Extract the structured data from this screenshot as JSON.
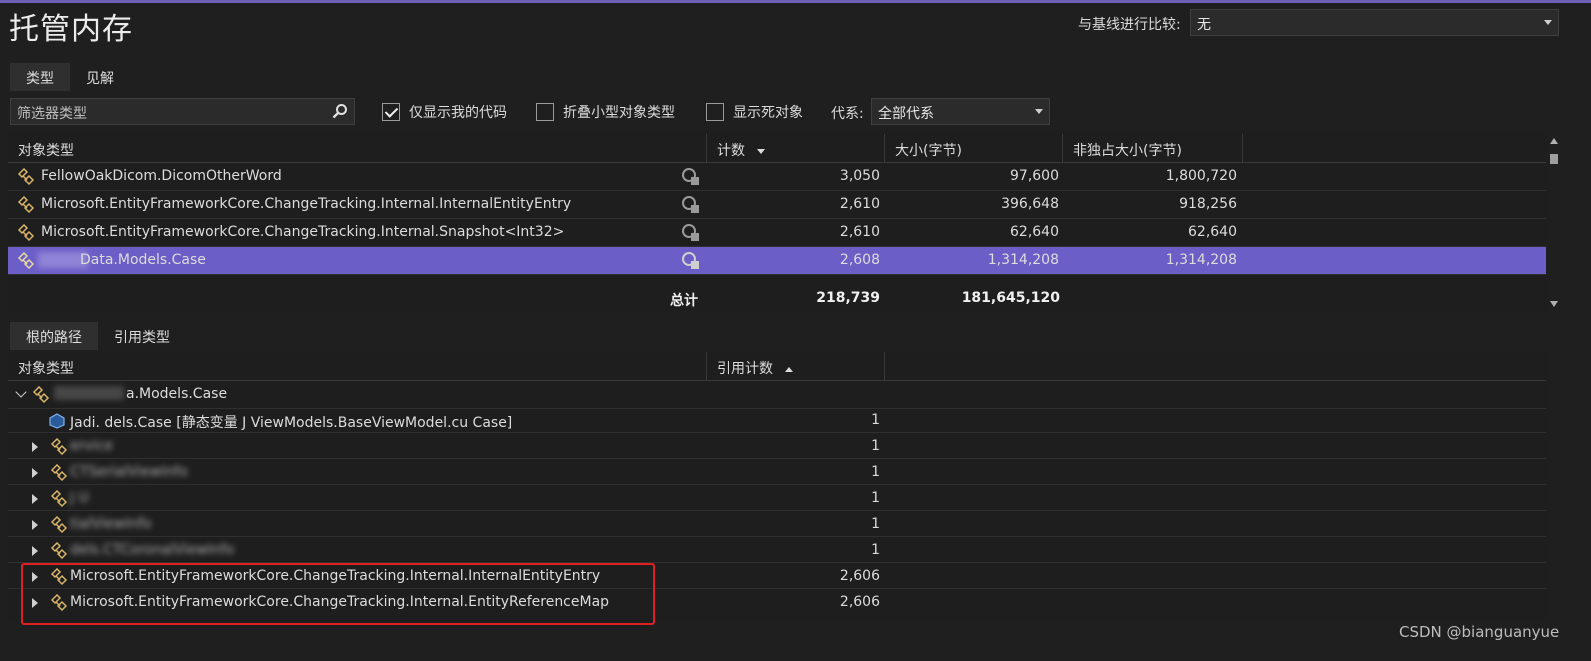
{
  "title": "托管内存",
  "compare": {
    "label": "与基线进行比较:",
    "value": "无"
  },
  "top_tabs": [
    {
      "label": "类型"
    },
    {
      "label": "见解"
    }
  ],
  "toolbar": {
    "filter_placeholder": "筛选器类型",
    "just_my_code": {
      "label": "仅显示我的代码",
      "checked": true
    },
    "collapse_small": {
      "label": "折叠小型对象类型",
      "checked": false
    },
    "show_dead": {
      "label": "显示死对象",
      "checked": false
    },
    "generation_label": "代系:",
    "generation_value": "全部代系"
  },
  "types_table": {
    "headers": {
      "type": "对象类型",
      "count": "计数",
      "size": "大小(字节)",
      "inclusive": "非独占大小(字节)"
    },
    "rows": [
      {
        "type": "FellowOakDicom.DicomOtherWord",
        "count": "3,050",
        "size": "97,600",
        "inclusive": "1,800,720"
      },
      {
        "type": "Microsoft.EntityFrameworkCore.ChangeTracking.Internal.InternalEntityEntry",
        "count": "2,610",
        "size": "396,648",
        "inclusive": "918,256"
      },
      {
        "type": "Microsoft.EntityFrameworkCore.ChangeTracking.Internal.Snapshot<Int32>",
        "count": "2,610",
        "size": "62,640",
        "inclusive": "62,640"
      },
      {
        "type": "Data.Models.Case",
        "count": "2,608",
        "size": "1,314,208",
        "inclusive": "1,314,208"
      }
    ],
    "total": {
      "label": "总计",
      "count": "218,739",
      "size": "181,645,120"
    }
  },
  "bottom_tabs": [
    {
      "label": "根的路径"
    },
    {
      "label": "引用类型"
    }
  ],
  "paths_table": {
    "headers": {
      "type": "对象类型",
      "ref_count": "引用计数"
    },
    "root": {
      "label": "a.Models.Case"
    },
    "rows": [
      {
        "label": "Jadi.  dels.Case [静态变量 J   ViewModels.BaseViewModel.cu   Case]",
        "count": "1"
      },
      {
        "label": "                ervice",
        "count": "1"
      },
      {
        "label": "          CTSerialViewInfo",
        "count": "1"
      },
      {
        "label": "J           U",
        "count": "1"
      },
      {
        "label": "                 tialViewInfo",
        "count": "1"
      },
      {
        "label": "           dels.CTCoronalViewInfo",
        "count": "1"
      },
      {
        "label": "Microsoft.EntityFrameworkCore.ChangeTracking.Internal.InternalEntityEntry",
        "count": "2,606"
      },
      {
        "label": "Microsoft.EntityFrameworkCore.ChangeTracking.Internal.EntityReferenceMap",
        "count": "2,606"
      }
    ]
  },
  "watermark": "CSDN @bianguanyue",
  "colors": {
    "accent": "#6c5ec7",
    "highlight": "#e02020",
    "background": "#1f1f1f"
  }
}
